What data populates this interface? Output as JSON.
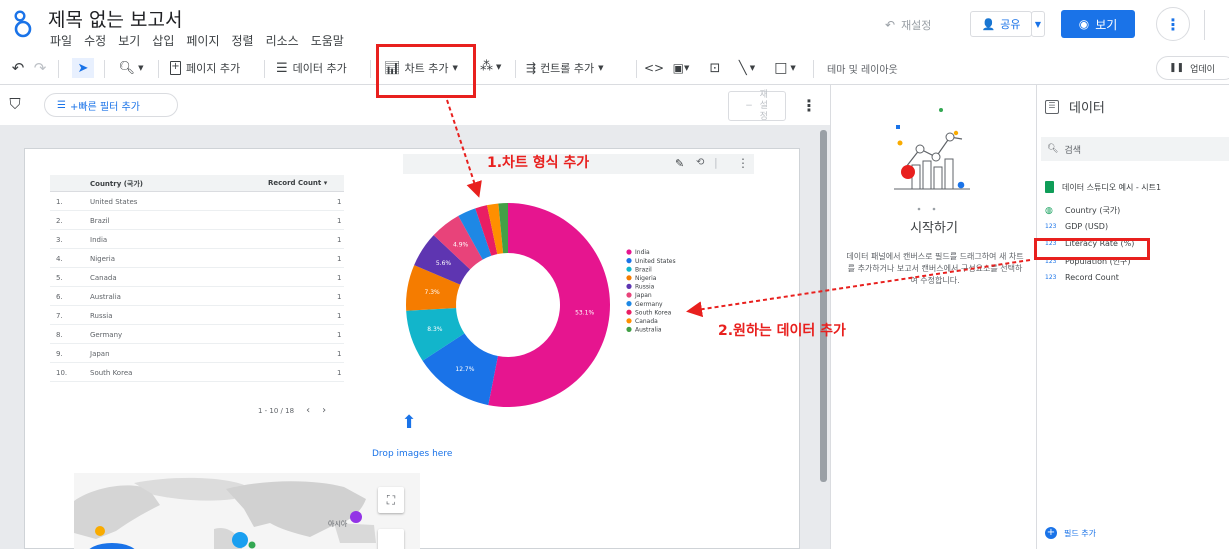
{
  "header": {
    "title": "제목 없는 보고서",
    "menu": [
      "파일",
      "수정",
      "보기",
      "삽입",
      "페이지",
      "정렬",
      "리소스",
      "도움말"
    ],
    "reset_label": "재설정",
    "share_label": "공유",
    "view_label": "보기"
  },
  "toolbar": {
    "add_page": "페이지 추가",
    "add_data": "데이터 추가",
    "add_chart": "차트 추가",
    "add_control": "컨트롤 추가",
    "theme_layout": "테마 및 레이아웃",
    "update": "업데이"
  },
  "filterbar": {
    "quick_filter": "+빠른 필터 추가",
    "reset_vertical": "재 설 정"
  },
  "table": {
    "headers": [
      "Country (국가)",
      "Record Count"
    ],
    "sort_mark": "▾",
    "rows": [
      {
        "n": "1.",
        "country": "United States",
        "count": "1"
      },
      {
        "n": "2.",
        "country": "Brazil",
        "count": "1"
      },
      {
        "n": "3.",
        "country": "India",
        "count": "1"
      },
      {
        "n": "4.",
        "country": "Nigeria",
        "count": "1"
      },
      {
        "n": "5.",
        "country": "Canada",
        "count": "1"
      },
      {
        "n": "6.",
        "country": "Australia",
        "count": "1"
      },
      {
        "n": "7.",
        "country": "Russia",
        "count": "1"
      },
      {
        "n": "8.",
        "country": "Germany",
        "count": "1"
      },
      {
        "n": "9.",
        "country": "Japan",
        "count": "1"
      },
      {
        "n": "10.",
        "country": "South Korea",
        "count": "1"
      }
    ],
    "pagination": "1 - 10 / 18"
  },
  "chart_data": {
    "type": "pie",
    "donut": true,
    "categories": [
      "India",
      "United States",
      "Brazil",
      "Nigeria",
      "Russia",
      "Japan",
      "Germany",
      "South Korea",
      "Canada",
      "Australia"
    ],
    "values": [
      53.1,
      12.7,
      8.3,
      7.3,
      5.6,
      4.9,
      2.9,
      1.9,
      1.8,
      1.5
    ],
    "value_labels": [
      "53.1%",
      "12.7%",
      "8.3%",
      "7.3%",
      "5.6%",
      "4.9%",
      "",
      "",
      "",
      ""
    ],
    "colors": [
      "#e6158f",
      "#1a73e8",
      "#12b5cb",
      "#f57c00",
      "#5e35b1",
      "#e8437a",
      "#1e88e5",
      "#e91e63",
      "#ff8f00",
      "#43a047"
    ],
    "legend_placement": "right"
  },
  "annotations": {
    "step1": "1.차트 형식 추가",
    "step2": "2.원하는 데이터 추가"
  },
  "drop_images": "Drop images here",
  "map": {
    "place_label": "아시아"
  },
  "get_started": {
    "title": "시작하기",
    "body": "데이터 패널에서 캔버스로 필드를 드래그하여 새 차트를 추가하거나 보고서 캔버스에서 구성요소를 선택하여 수정합니다."
  },
  "data_panel": {
    "title": "데이터",
    "search_placeholder": "검색",
    "source": "데이터 스튜디오 예시 - 시트1",
    "fields": [
      {
        "type": "geo",
        "label": "Country (국가)"
      },
      {
        "type": "123",
        "label": "GDP (USD)"
      },
      {
        "type": "123",
        "label": "Literacy Rate (%)"
      },
      {
        "type": "123",
        "label": "Population (인구)"
      },
      {
        "type": "123",
        "label": "Record Count"
      }
    ],
    "add_field": "필드 추가"
  }
}
